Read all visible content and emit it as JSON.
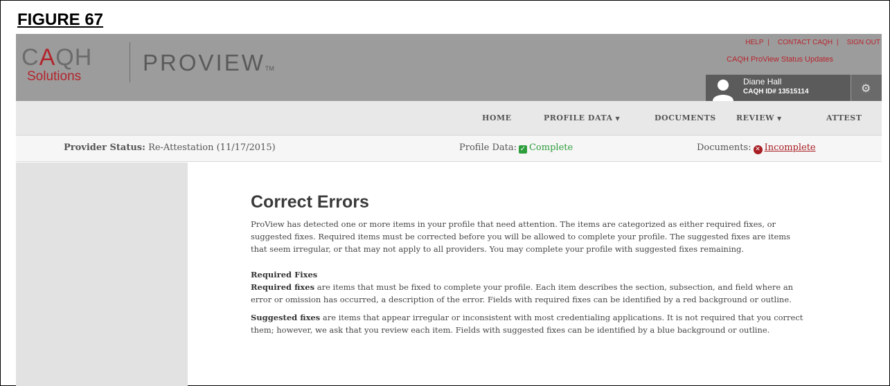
{
  "figure_label": "FIGURE 67",
  "logo": {
    "caqh_c": "C",
    "caqh_a": "A",
    "caqh_qh": "QH",
    "solutions": "Solutions",
    "product": "PROVIEW",
    "tm": "TM"
  },
  "header_links": {
    "help": "HELP",
    "contact": "CONTACT CAQH",
    "signout": "SIGN OUT",
    "status_updates": "CAQH ProView Status Updates"
  },
  "user": {
    "name": "Diane Hall",
    "id": "CAQH ID# 13515114"
  },
  "nav": {
    "home": "HOME",
    "profile_data": "PROFILE DATA",
    "documents": "DOCUMENTS",
    "review": "REVIEW",
    "attest": "ATTEST",
    "caret": "▼"
  },
  "status": {
    "provider_label": "Provider Status:",
    "provider_value": "Re-Attestation (11/17/2015)",
    "profile_label": "Profile Data:",
    "profile_value": "Complete",
    "documents_label": "Documents:",
    "documents_value": "Incomplete"
  },
  "content": {
    "title": "Correct Errors",
    "intro": "ProView has detected one or more items in your profile that need attention. The items are categorized as either required fixes, or suggested fixes. Required items must be corrected before you will be allowed to complete your profile. The suggested fixes are items that seem irregular, or that may not apply to all providers. You may complete your profile with suggested fixes remaining.",
    "required_heading": "Required Fixes",
    "required_bold": "Required fixes",
    "required_text": " are items that must be fixed to complete your profile. Each item describes the section, subsection, and field where an error or omission has occurred, a description of the error. Fields with required fixes can be identified by a red background or outline.",
    "suggested_bold": "Suggested fixes",
    "suggested_text": " are items that appear irregular or inconsistent with most credentialing applications. It is not required that you correct them; however, we ask that you review each item. Fields with suggested fixes can be identified by a blue background or outline."
  },
  "colors": {
    "header_bg": "#9c9c9c",
    "brand_red": "#b2242c",
    "complete_green": "#2e9e3d",
    "incomplete_red": "#a81c22"
  },
  "icons": {
    "check": "check-icon",
    "error": "x-circle-icon",
    "gear": "gear-icon",
    "avatar": "avatar-icon"
  }
}
